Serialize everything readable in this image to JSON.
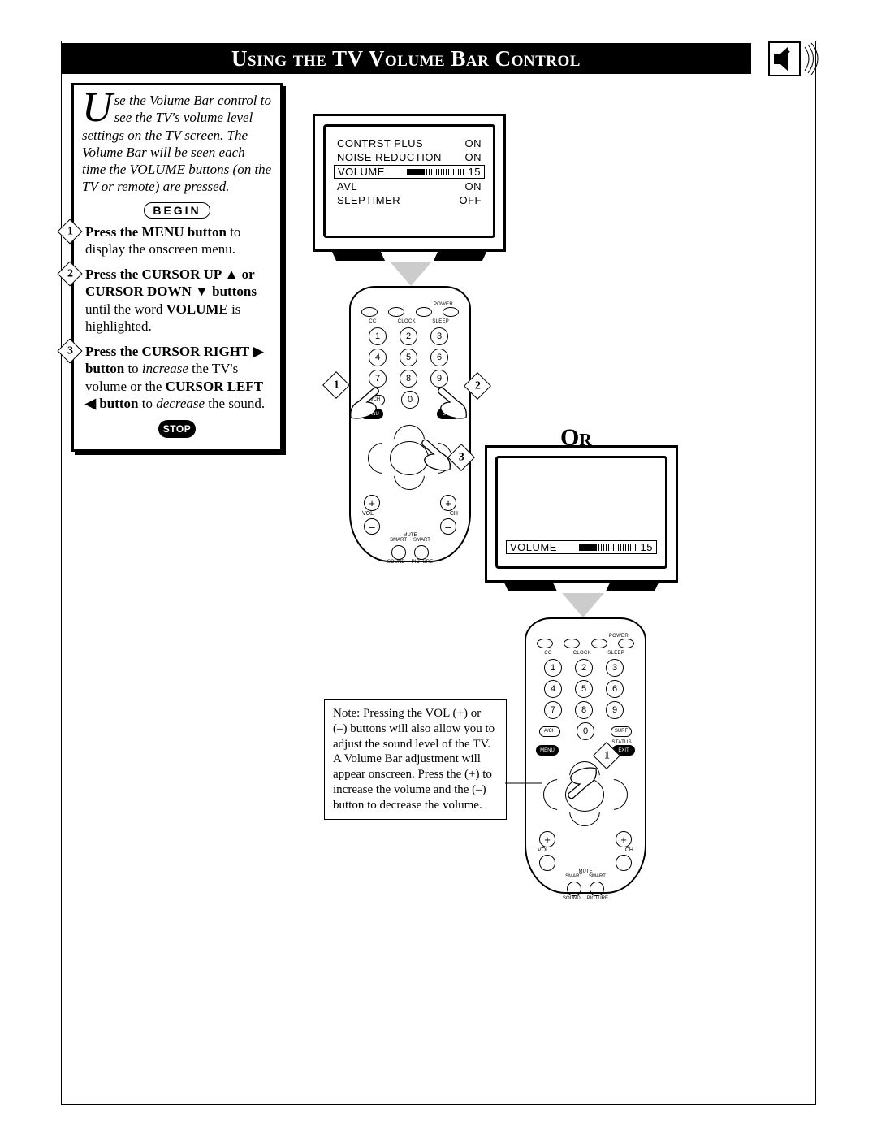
{
  "title": "Using the TV Volume Bar Control",
  "intro": {
    "dropcap": "U",
    "text": "se the Volume Bar control to see the TV's volume level settings on the TV screen. The Volume Bar will be seen each time the VOLUME buttons (on the TV or remote) are pressed."
  },
  "begin": "BEGIN",
  "stop": "STOP",
  "steps": [
    {
      "n": "1",
      "bold": "Press the MENU button",
      "rest": " to display the onscreen menu."
    },
    {
      "n": "2",
      "bold": "Press the CURSOR UP ▲ or CURSOR DOWN ▼ buttons",
      "rest": " until the word ",
      "bold2": "VOLUME",
      "rest2": " is highlighted."
    },
    {
      "n": "3",
      "bold": "Press the CURSOR RIGHT ▶ button",
      "rest": " to ",
      "ital": "increase",
      "rest2": " the TV's volume or the ",
      "bold2": "CURSOR LEFT ◀ button",
      "rest3": " to ",
      "ital2": "decrease",
      "rest4": " the sound."
    }
  ],
  "tv1": {
    "rows": [
      {
        "label": "CONTRST PLUS",
        "value": "ON"
      },
      {
        "label": "NOISE REDUCTION",
        "value": "ON"
      },
      {
        "label": "VOLUME",
        "value": "15",
        "selected": true,
        "bar_pct": 30
      },
      {
        "label": "AVL",
        "value": "ON"
      },
      {
        "label": "SLEPTIMER",
        "value": "OFF"
      }
    ]
  },
  "tv2": {
    "label": "VOLUME",
    "value": "15",
    "bar_pct": 30
  },
  "or": "Or",
  "note": "Note: Pressing the VOL (+) or (–) buttons will also allow you to adjust the sound level of the TV. A Volume Bar adjustment will appear onscreen. Press the (+) to increase the volume and the (–) button to decrease the volume.",
  "remote": {
    "toplabels": [
      "CC",
      "CLOCK",
      "SLEEP"
    ],
    "power": "POWER",
    "ach": "A/CH",
    "menu": "MENU",
    "exit": "EXIT",
    "surf": "SURF",
    "status": "STATUS",
    "vol": "VOL",
    "ch": "CH",
    "mute": "MUTE",
    "smart1": "SMART",
    "smart2": "SMART",
    "sound": "SOUND",
    "picture": "PICTURE"
  },
  "callouts": {
    "r1": [
      "1",
      "2",
      "3"
    ],
    "r2": [
      "1"
    ]
  }
}
